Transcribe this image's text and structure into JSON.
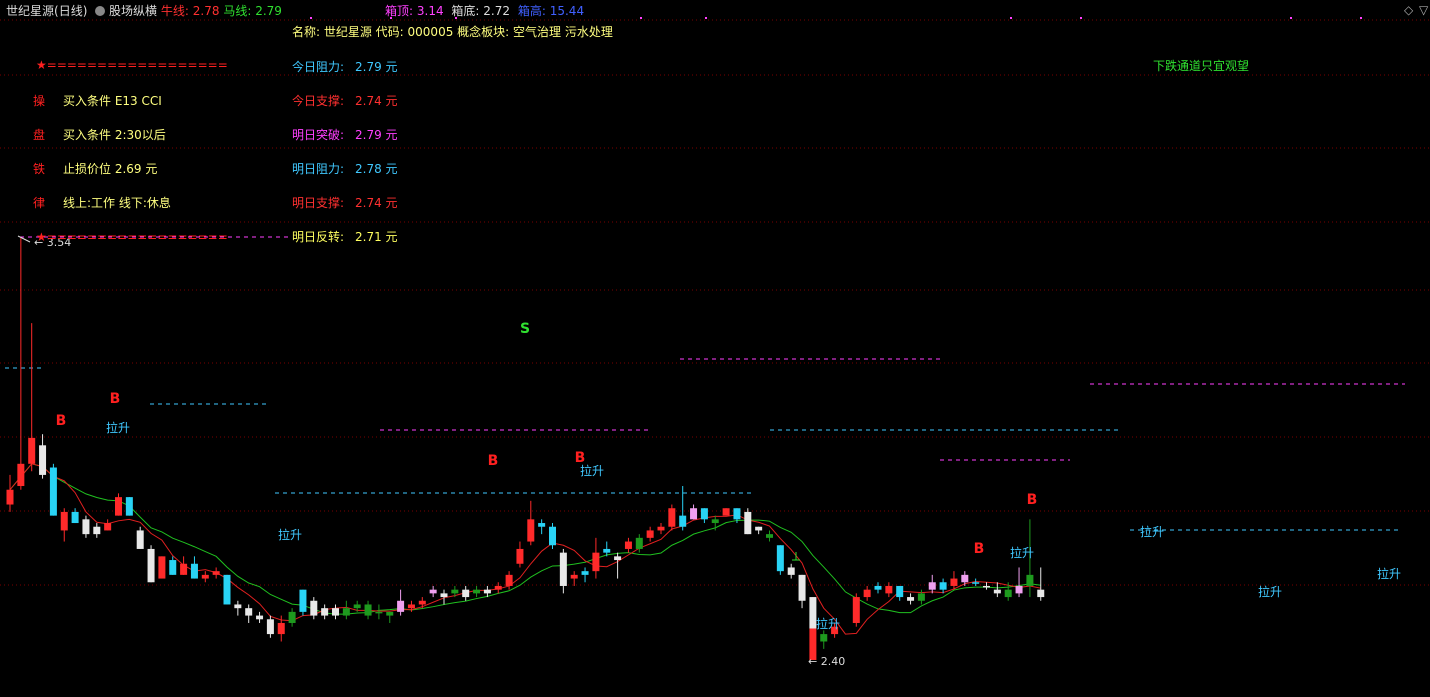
{
  "header": {
    "title": "世纪星源",
    "period": "(日线)",
    "indicator": "股场纵横",
    "bull_label": "牛线:",
    "bull_value": "2.78",
    "horse_label": "马线:",
    "horse_value": "2.79",
    "box_top_label": "箱顶:",
    "box_top_value": "3.14",
    "box_bottom_label": "箱底:",
    "box_bottom_value": "2.72",
    "box_height_label": "箱高:",
    "box_height_value": "15.44"
  },
  "colors": {
    "up": "#ff2a2a",
    "down_cyan": "#29d3f5",
    "down_white": "#e8e8e8",
    "down_green": "#1e9a1e",
    "pink": "#f0a0f0",
    "bull_line": "#e02020",
    "horse_line": "#20c020",
    "grid": "#7a0000"
  },
  "info": {
    "name_line": "名称: 世纪星源 代码: 000005 概念板块: 空气治理 污水处理",
    "star_line": "★==================",
    "star_line2": "★==================",
    "rules": [
      {
        "key": "操",
        "text": "买入条件 E13 CCI"
      },
      {
        "key": "盘",
        "text": "买入条件 2:30以后"
      },
      {
        "key": "铁",
        "text": "止损价位 2.69 元"
      },
      {
        "key": "律",
        "text": "线上:工作 线下:休息"
      }
    ],
    "levels": [
      {
        "label": "今日阻力:",
        "value": "2.79 元",
        "color": "#40c8ff"
      },
      {
        "label": "今日支撑:",
        "value": "2.74 元",
        "color": "#ff3030"
      },
      {
        "label": "明日突破:",
        "value": "2.79 元",
        "color": "#ff40ff"
      },
      {
        "label": "明日阻力:",
        "value": "2.78 元",
        "color": "#40c8ff"
      },
      {
        "label": "明日支撑:",
        "value": "2.74 元",
        "color": "#ff3030"
      },
      {
        "label": "明日反转:",
        "value": "2.71 元",
        "color": "#ffff60"
      }
    ],
    "trend_note": "下跌通道只宜观望"
  },
  "chart_data": {
    "type": "candlestick",
    "ylim": [
      2.3,
      3.6
    ],
    "max_label": "3.54",
    "min_label": "2.40",
    "candles": [
      {
        "o": 2.82,
        "c": 2.86,
        "h": 2.9,
        "l": 2.8,
        "k": "up"
      },
      {
        "o": 2.87,
        "c": 2.93,
        "h": 3.54,
        "l": 2.86,
        "k": "up"
      },
      {
        "o": 2.93,
        "c": 3.0,
        "h": 3.31,
        "l": 2.91,
        "k": "up"
      },
      {
        "o": 2.98,
        "c": 2.9,
        "h": 3.01,
        "l": 2.89,
        "k": "white"
      },
      {
        "o": 2.92,
        "c": 2.79,
        "h": 2.93,
        "l": 2.79,
        "k": "cyan"
      },
      {
        "o": 2.75,
        "c": 2.8,
        "h": 2.81,
        "l": 2.72,
        "k": "up"
      },
      {
        "o": 2.8,
        "c": 2.77,
        "h": 2.81,
        "l": 2.77,
        "k": "cyan"
      },
      {
        "o": 2.78,
        "c": 2.74,
        "h": 2.79,
        "l": 2.73,
        "k": "white"
      },
      {
        "o": 2.74,
        "c": 2.76,
        "h": 2.77,
        "l": 2.73,
        "k": "white"
      },
      {
        "o": 2.75,
        "c": 2.77,
        "h": 2.78,
        "l": 2.75,
        "k": "up"
      },
      {
        "o": 2.79,
        "c": 2.84,
        "h": 2.85,
        "l": 2.79,
        "k": "up"
      },
      {
        "o": 2.84,
        "c": 2.79,
        "h": 2.84,
        "l": 2.79,
        "k": "cyan"
      },
      {
        "o": 2.75,
        "c": 2.7,
        "h": 2.76,
        "l": 2.7,
        "k": "white"
      },
      {
        "o": 2.7,
        "c": 2.61,
        "h": 2.71,
        "l": 2.61,
        "k": "white"
      },
      {
        "o": 2.62,
        "c": 2.68,
        "h": 2.68,
        "l": 2.62,
        "k": "up"
      },
      {
        "o": 2.67,
        "c": 2.63,
        "h": 2.68,
        "l": 2.63,
        "k": "cyan"
      },
      {
        "o": 2.63,
        "c": 2.66,
        "h": 2.68,
        "l": 2.63,
        "k": "up"
      },
      {
        "o": 2.66,
        "c": 2.62,
        "h": 2.68,
        "l": 2.62,
        "k": "cyan"
      },
      {
        "o": 2.62,
        "c": 2.63,
        "h": 2.64,
        "l": 2.61,
        "k": "up"
      },
      {
        "o": 2.63,
        "c": 2.64,
        "h": 2.65,
        "l": 2.62,
        "k": "up"
      },
      {
        "o": 2.63,
        "c": 2.55,
        "h": 2.63,
        "l": 2.55,
        "k": "cyan"
      },
      {
        "o": 2.55,
        "c": 2.54,
        "h": 2.56,
        "l": 2.52,
        "k": "white"
      },
      {
        "o": 2.54,
        "c": 2.52,
        "h": 2.55,
        "l": 2.5,
        "k": "white"
      },
      {
        "o": 2.52,
        "c": 2.51,
        "h": 2.53,
        "l": 2.5,
        "k": "white"
      },
      {
        "o": 2.51,
        "c": 2.47,
        "h": 2.52,
        "l": 2.46,
        "k": "white"
      },
      {
        "o": 2.47,
        "c": 2.5,
        "h": 2.52,
        "l": 2.45,
        "k": "up"
      },
      {
        "o": 2.5,
        "c": 2.53,
        "h": 2.54,
        "l": 2.49,
        "k": "green"
      },
      {
        "o": 2.53,
        "c": 2.59,
        "h": 2.59,
        "l": 2.52,
        "k": "cyan"
      },
      {
        "o": 2.56,
        "c": 2.52,
        "h": 2.57,
        "l": 2.51,
        "k": "white"
      },
      {
        "o": 2.52,
        "c": 2.54,
        "h": 2.55,
        "l": 2.51,
        "k": "white"
      },
      {
        "o": 2.54,
        "c": 2.52,
        "h": 2.55,
        "l": 2.51,
        "k": "white"
      },
      {
        "o": 2.52,
        "c": 2.54,
        "h": 2.56,
        "l": 2.51,
        "k": "green"
      },
      {
        "o": 2.54,
        "c": 2.55,
        "h": 2.56,
        "l": 2.53,
        "k": "green"
      },
      {
        "o": 2.55,
        "c": 2.52,
        "h": 2.56,
        "l": 2.51,
        "k": "green"
      },
      {
        "o": 2.53,
        "c": 2.53,
        "h": 2.55,
        "l": 2.51,
        "k": "green"
      },
      {
        "o": 2.53,
        "c": 2.52,
        "h": 2.53,
        "l": 2.5,
        "k": "green"
      },
      {
        "o": 2.53,
        "c": 2.56,
        "h": 2.59,
        "l": 2.52,
        "k": "pink"
      },
      {
        "o": 2.54,
        "c": 2.55,
        "h": 2.56,
        "l": 2.53,
        "k": "up"
      },
      {
        "o": 2.55,
        "c": 2.56,
        "h": 2.57,
        "l": 2.54,
        "k": "up"
      },
      {
        "o": 2.58,
        "c": 2.59,
        "h": 2.6,
        "l": 2.57,
        "k": "pink"
      },
      {
        "o": 2.57,
        "c": 2.58,
        "h": 2.59,
        "l": 2.55,
        "k": "white"
      },
      {
        "o": 2.58,
        "c": 2.59,
        "h": 2.6,
        "l": 2.57,
        "k": "green"
      },
      {
        "o": 2.57,
        "c": 2.59,
        "h": 2.6,
        "l": 2.56,
        "k": "white"
      },
      {
        "o": 2.58,
        "c": 2.59,
        "h": 2.6,
        "l": 2.57,
        "k": "green"
      },
      {
        "o": 2.58,
        "c": 2.59,
        "h": 2.6,
        "l": 2.57,
        "k": "white"
      },
      {
        "o": 2.59,
        "c": 2.6,
        "h": 2.61,
        "l": 2.58,
        "k": "up"
      },
      {
        "o": 2.6,
        "c": 2.63,
        "h": 2.64,
        "l": 2.59,
        "k": "up"
      },
      {
        "o": 2.66,
        "c": 2.7,
        "h": 2.72,
        "l": 2.65,
        "k": "up"
      },
      {
        "o": 2.72,
        "c": 2.78,
        "h": 2.83,
        "l": 2.71,
        "k": "up"
      },
      {
        "o": 2.77,
        "c": 2.76,
        "h": 2.78,
        "l": 2.74,
        "k": "cyan"
      },
      {
        "o": 2.76,
        "c": 2.71,
        "h": 2.77,
        "l": 2.7,
        "k": "cyan"
      },
      {
        "o": 2.69,
        "c": 2.6,
        "h": 2.7,
        "l": 2.58,
        "k": "white"
      },
      {
        "o": 2.62,
        "c": 2.63,
        "h": 2.64,
        "l": 2.6,
        "k": "up"
      },
      {
        "o": 2.63,
        "c": 2.64,
        "h": 2.65,
        "l": 2.61,
        "k": "cyan"
      },
      {
        "o": 2.64,
        "c": 2.69,
        "h": 2.73,
        "l": 2.62,
        "k": "up"
      },
      {
        "o": 2.69,
        "c": 2.7,
        "h": 2.72,
        "l": 2.68,
        "k": "cyan"
      },
      {
        "o": 2.68,
        "c": 2.67,
        "h": 2.69,
        "l": 2.62,
        "k": "white"
      },
      {
        "o": 2.7,
        "c": 2.72,
        "h": 2.73,
        "l": 2.69,
        "k": "up"
      },
      {
        "o": 2.7,
        "c": 2.73,
        "h": 2.74,
        "l": 2.69,
        "k": "green"
      },
      {
        "o": 2.73,
        "c": 2.75,
        "h": 2.76,
        "l": 2.72,
        "k": "up"
      },
      {
        "o": 2.75,
        "c": 2.76,
        "h": 2.77,
        "l": 2.74,
        "k": "up"
      },
      {
        "o": 2.76,
        "c": 2.81,
        "h": 2.82,
        "l": 2.75,
        "k": "up"
      },
      {
        "o": 2.79,
        "c": 2.76,
        "h": 2.87,
        "l": 2.75,
        "k": "cyan"
      },
      {
        "o": 2.78,
        "c": 2.81,
        "h": 2.82,
        "l": 2.78,
        "k": "pink"
      },
      {
        "o": 2.81,
        "c": 2.78,
        "h": 2.81,
        "l": 2.77,
        "k": "cyan"
      },
      {
        "o": 2.77,
        "c": 2.78,
        "h": 2.79,
        "l": 2.75,
        "k": "green"
      },
      {
        "o": 2.79,
        "c": 2.81,
        "h": 2.81,
        "l": 2.79,
        "k": "up"
      },
      {
        "o": 2.81,
        "c": 2.78,
        "h": 2.81,
        "l": 2.77,
        "k": "cyan"
      },
      {
        "o": 2.8,
        "c": 2.74,
        "h": 2.81,
        "l": 2.74,
        "k": "white"
      },
      {
        "o": 2.76,
        "c": 2.75,
        "h": 2.76,
        "l": 2.74,
        "k": "white"
      },
      {
        "o": 2.74,
        "c": 2.73,
        "h": 2.75,
        "l": 2.72,
        "k": "green"
      },
      {
        "o": 2.71,
        "c": 2.64,
        "h": 2.71,
        "l": 2.63,
        "k": "cyan"
      },
      {
        "o": 2.65,
        "c": 2.63,
        "h": 2.66,
        "l": 2.62,
        "k": "white"
      },
      {
        "o": 2.63,
        "c": 2.56,
        "h": 2.63,
        "l": 2.54,
        "k": "white"
      },
      {
        "o": 2.57,
        "c": 2.4,
        "h": 2.57,
        "l": 2.4,
        "k": "upwhite"
      },
      {
        "o": 2.45,
        "c": 2.47,
        "h": 2.48,
        "l": 2.43,
        "k": "green"
      },
      {
        "o": 2.47,
        "c": 2.49,
        "h": 2.5,
        "l": 2.46,
        "k": "up"
      },
      {
        "o": 2.5,
        "c": 2.43,
        "h": 2.4,
        "l": 2.41,
        "k": "none"
      },
      {
        "o": 2.5,
        "c": 2.57,
        "h": 2.58,
        "l": 2.49,
        "k": "up"
      },
      {
        "o": 2.57,
        "c": 2.59,
        "h": 2.6,
        "l": 2.56,
        "k": "up"
      },
      {
        "o": 2.59,
        "c": 2.6,
        "h": 2.61,
        "l": 2.58,
        "k": "cyan"
      },
      {
        "o": 2.58,
        "c": 2.6,
        "h": 2.61,
        "l": 2.57,
        "k": "up"
      },
      {
        "o": 2.6,
        "c": 2.57,
        "h": 2.6,
        "l": 2.56,
        "k": "cyan"
      },
      {
        "o": 2.57,
        "c": 2.56,
        "h": 2.58,
        "l": 2.55,
        "k": "white"
      },
      {
        "o": 2.56,
        "c": 2.58,
        "h": 2.59,
        "l": 2.55,
        "k": "green"
      },
      {
        "o": 2.59,
        "c": 2.61,
        "h": 2.63,
        "l": 2.58,
        "k": "pink"
      },
      {
        "o": 2.61,
        "c": 2.59,
        "h": 2.62,
        "l": 2.58,
        "k": "cyan"
      },
      {
        "o": 2.6,
        "c": 2.62,
        "h": 2.64,
        "l": 2.59,
        "k": "up"
      },
      {
        "o": 2.61,
        "c": 2.63,
        "h": 2.64,
        "l": 2.6,
        "k": "pink"
      },
      {
        "o": 2.61,
        "c": 2.61,
        "h": 2.62,
        "l": 2.6,
        "k": "cyan"
      },
      {
        "o": 2.6,
        "c": 2.6,
        "h": 2.61,
        "l": 2.59,
        "k": "white"
      },
      {
        "o": 2.59,
        "c": 2.58,
        "h": 2.61,
        "l": 2.57,
        "k": "white"
      },
      {
        "o": 2.57,
        "c": 2.59,
        "h": 2.61,
        "l": 2.56,
        "k": "green"
      },
      {
        "o": 2.58,
        "c": 2.6,
        "h": 2.65,
        "l": 2.57,
        "k": "pink"
      },
      {
        "o": 2.6,
        "c": 2.63,
        "h": 2.78,
        "l": 2.57,
        "k": "green"
      },
      {
        "o": 2.59,
        "c": 2.57,
        "h": 2.65,
        "l": 2.56,
        "k": "white"
      }
    ],
    "signals": [
      "B",
      "S"
    ],
    "pull_up_label": "拉升"
  }
}
